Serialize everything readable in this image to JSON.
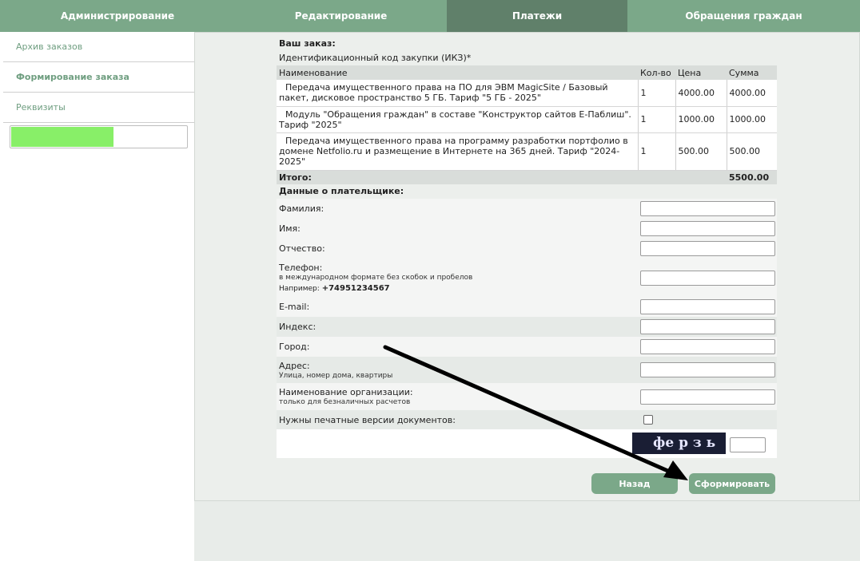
{
  "nav": {
    "tabs": [
      {
        "label": "Администрирование"
      },
      {
        "label": "Редактирование"
      },
      {
        "label": "Платежи"
      },
      {
        "label": "Обращения граждан"
      }
    ]
  },
  "sidebar": {
    "items": [
      {
        "label": "Архив заказов"
      },
      {
        "label": "Формирование заказа"
      },
      {
        "label": "Реквизиты"
      }
    ],
    "progress": 0.58
  },
  "order": {
    "title": "Ваш заказ:",
    "ikz_label": "Идентификационный код закупки (ИКЗ)*",
    "columns": [
      "Наименование",
      "Кол-во",
      "Цена",
      "Сумма"
    ],
    "rows": [
      {
        "name": "Передача имущественного права на ПО для ЭВМ MagicSite / Базовый пакет, дисковое пространство 5 ГБ. Тариф \"5 ГБ - 2025\"",
        "qty": "1",
        "price": "4000.00",
        "sum": "4000.00"
      },
      {
        "name": "Модуль \"Обращения граждан\" в составе \"Конструктор сайтов Е-Паблиш\". Тариф \"2025\"",
        "qty": "1",
        "price": "1000.00",
        "sum": "1000.00"
      },
      {
        "name": "Передача имущественного права на программу разработки портфолио в домене Netfolio.ru и размещение в Интернете на 365 дней. Тариф \"2024-2025\"",
        "qty": "1",
        "price": "500.00",
        "sum": "500.00"
      }
    ],
    "total_label": "Итого:",
    "total_value": "5500.00"
  },
  "payer": {
    "title": "Данные о плательщике:",
    "surname_label": "Фамилия:",
    "name_label": "Имя:",
    "patronymic_label": "Отчество:",
    "phone_label": "Телефон:",
    "phone_hint": "в международном формате без скобок и пробелов",
    "phone_example_label": "Например:",
    "phone_example": "+74951234567",
    "email_label": "E-mail:",
    "index_label": "Индекс:",
    "city_label": "Город:",
    "address_label": "Адрес:",
    "address_hint": "Улица, номер дома, квартиры",
    "org_label": "Наименование организации:",
    "org_hint": "только для безналичных расчетов",
    "print_label": "Нужны печатные версии документов:",
    "captcha_text": "фе р з ь"
  },
  "buttons": {
    "back": "Назад",
    "submit": "Сформировать"
  }
}
